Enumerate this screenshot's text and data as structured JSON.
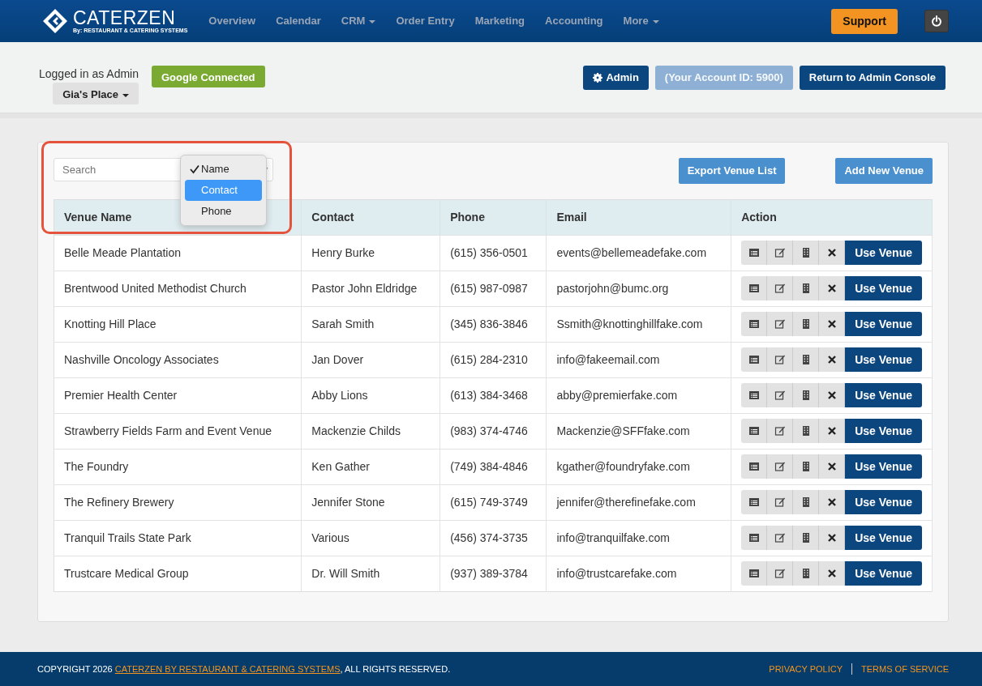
{
  "brand": {
    "name": "CATERZEN",
    "tagline": "By: RESTAURANT & CATERING SYSTEMS"
  },
  "nav": [
    {
      "label": "Overview",
      "has_menu": false
    },
    {
      "label": "Calendar",
      "has_menu": false
    },
    {
      "label": "CRM",
      "has_menu": true
    },
    {
      "label": "Order Entry",
      "has_menu": false
    },
    {
      "label": "Marketing",
      "has_menu": false
    },
    {
      "label": "Accounting",
      "has_menu": false
    },
    {
      "label": "More",
      "has_menu": true
    }
  ],
  "support_button": "Support",
  "account": {
    "logged_in": "Logged in as Admin",
    "location": "Gia's Place",
    "google": "Google Connected",
    "admin": "Admin",
    "account_id": "(Your Account ID: 5900)",
    "return": "Return to Admin Console"
  },
  "toolbar": {
    "search": {
      "placeholder": "Search"
    },
    "search_by": [
      {
        "label": "Name",
        "checked": true,
        "hovered": false
      },
      {
        "label": "Contact",
        "checked": false,
        "hovered": true
      },
      {
        "label": "Phone",
        "checked": false,
        "hovered": false
      }
    ],
    "buttons": [
      "Export Venue List",
      "Add New Venue"
    ]
  },
  "table": {
    "columns": [
      "Venue Name",
      "Contact",
      "Phone",
      "Email",
      "Action"
    ],
    "rows": [
      {
        "cells": [
          "Belle Meade Plantation",
          "Henry Burke",
          "(615) 356-0501",
          "events@bellemeadefake.com"
        ],
        "action": "Use Venue"
      },
      {
        "cells": [
          "Brentwood United Methodist Church",
          "Pastor John Eldridge",
          "(615) 987-0987",
          "pastorjohn@bumc.org"
        ],
        "action": "Use Venue"
      },
      {
        "cells": [
          "Knotting Hill Place",
          "Sarah Smith",
          "(345) 836-3846",
          "Ssmith@knottinghillfake.com"
        ],
        "action": "Use Venue"
      },
      {
        "cells": [
          "Nashville Oncology Associates",
          "Jan Dover",
          "(615) 284-2310",
          "info@fakeemail.com"
        ],
        "action": "Use Venue"
      },
      {
        "cells": [
          "Premier Health Center",
          "Abby Lions",
          "(613) 384-3468",
          "abby@premierfake.com"
        ],
        "action": "Use Venue"
      },
      {
        "cells": [
          "Strawberry Fields Farm and Event Venue",
          "Mackenzie Childs",
          "(983) 374-4746",
          "Mackenzie@SFFfake.com"
        ],
        "action": "Use Venue"
      },
      {
        "cells": [
          "The Foundry",
          "Ken Gather",
          "(749) 384-4846",
          "kgather@foundryfake.com"
        ],
        "action": "Use Venue"
      },
      {
        "cells": [
          "The Refinery Brewery",
          "Jennifer Stone",
          "(615) 749-3749",
          "jennifer@therefinefake.com"
        ],
        "action": "Use Venue"
      },
      {
        "cells": [
          "Tranquil Trails State Park",
          "Various",
          "(456) 374-3735",
          "info@tranquilfake.com"
        ],
        "action": "Use Venue"
      },
      {
        "cells": [
          "Trustcare Medical Group",
          "Dr. Will Smith",
          "(937) 389-3784",
          "info@trustcarefake.com"
        ],
        "action": "Use Venue"
      }
    ]
  },
  "footer": {
    "copyright_start": "COPYRIGHT 2026",
    "company_link": "CATERZEN BY RESTAURANT & CATERING SYSTEMS",
    "copyright_end": ", ALL RIGHTS RESERVED.",
    "links": [
      "PRIVACY POLICY",
      "TERMS OF SERVICE"
    ]
  }
}
